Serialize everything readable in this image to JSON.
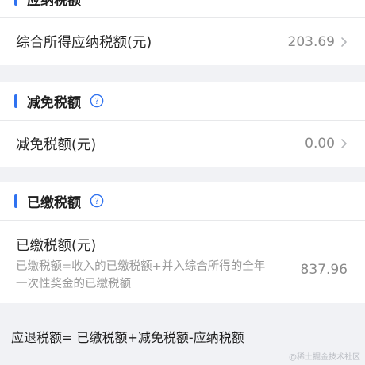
{
  "payable": {
    "title": "应纳税额",
    "row_label": "综合所得应纳税额(元)",
    "row_value": "203.69"
  },
  "reduction": {
    "title": "减免税额",
    "row_label": "减免税额(元)",
    "row_value": "0.00"
  },
  "paid": {
    "title": "已缴税额",
    "row_label": "已缴税额(元)",
    "row_desc_line1": "已缴税额=收入的已缴税额+并入综合所得的全年",
    "row_desc_line2": "一次性奖金的已缴税额",
    "row_value": "837.96"
  },
  "formula": "应退税额= 已缴税额+减免税额-应纳税额",
  "watermark": "@稀土掘金技术社区",
  "colors": {
    "accent": "#2f72f0",
    "background": "#f1f2f5"
  },
  "icons": {
    "help": "question-circle-icon",
    "chevron": "chevron-right-icon"
  }
}
